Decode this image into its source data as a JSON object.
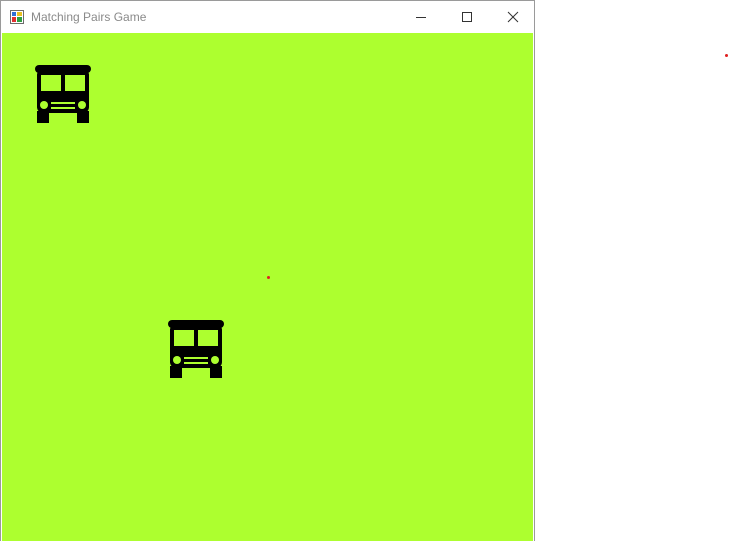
{
  "window": {
    "title": "Matching Pairs Game",
    "controls": [
      "minimize",
      "maximize",
      "close"
    ]
  },
  "board": {
    "rows": 4,
    "columns": 4,
    "background_color": "#adff2f",
    "icon_color": "#000000",
    "cells": [
      {
        "row": 1,
        "col": 1,
        "revealed": true,
        "icon": "bus-icon"
      },
      {
        "row": 1,
        "col": 2,
        "revealed": false,
        "icon": null
      },
      {
        "row": 1,
        "col": 3,
        "revealed": false,
        "icon": null
      },
      {
        "row": 1,
        "col": 4,
        "revealed": false,
        "icon": null
      },
      {
        "row": 2,
        "col": 1,
        "revealed": false,
        "icon": null
      },
      {
        "row": 2,
        "col": 2,
        "revealed": false,
        "icon": null
      },
      {
        "row": 2,
        "col": 3,
        "revealed": false,
        "icon": null
      },
      {
        "row": 2,
        "col": 4,
        "revealed": false,
        "icon": null
      },
      {
        "row": 3,
        "col": 1,
        "revealed": false,
        "icon": null
      },
      {
        "row": 3,
        "col": 2,
        "revealed": true,
        "icon": "bus-icon"
      },
      {
        "row": 3,
        "col": 3,
        "revealed": false,
        "icon": null
      },
      {
        "row": 3,
        "col": 4,
        "revealed": false,
        "icon": null
      },
      {
        "row": 4,
        "col": 1,
        "revealed": false,
        "icon": null
      },
      {
        "row": 4,
        "col": 2,
        "revealed": false,
        "icon": null
      },
      {
        "row": 4,
        "col": 3,
        "revealed": false,
        "icon": null
      },
      {
        "row": 4,
        "col": 4,
        "revealed": false,
        "icon": null
      }
    ]
  }
}
